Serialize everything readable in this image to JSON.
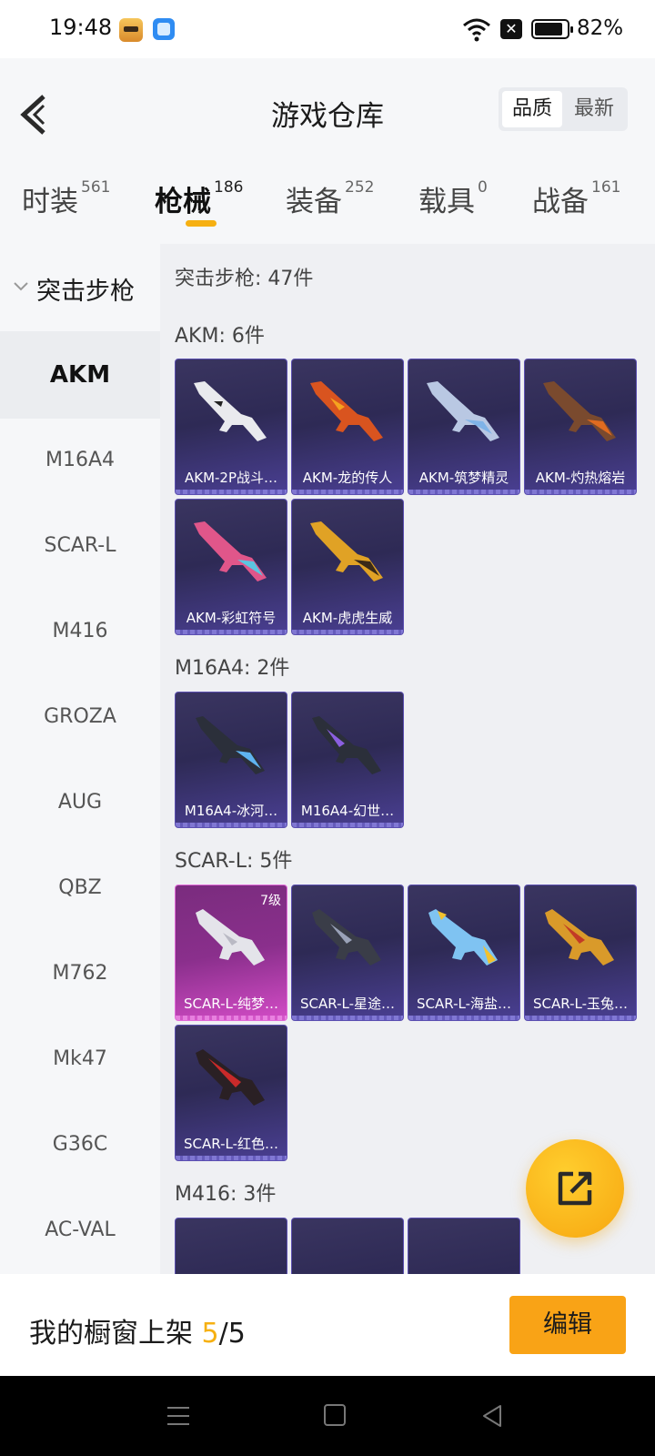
{
  "status_bar": {
    "time": "19:48",
    "battery": "82%"
  },
  "header": {
    "title": "游戏仓库",
    "sort_options": [
      "品质",
      "最新"
    ]
  },
  "tabs": [
    {
      "label": "时装",
      "count": "561"
    },
    {
      "label": "枪械",
      "count": "186"
    },
    {
      "label": "装备",
      "count": "252"
    },
    {
      "label": "载具",
      "count": "0"
    },
    {
      "label": "战备",
      "count": "161"
    }
  ],
  "sidebar": {
    "category": "突击步枪",
    "items": [
      "AKM",
      "M16A4",
      "SCAR-L",
      "M416",
      "GROZA",
      "AUG",
      "QBZ",
      "M762",
      "Mk47",
      "G36C",
      "AC-VAL"
    ]
  },
  "content": {
    "summary": "突击步枪: 47件",
    "sections": [
      {
        "title": "AKM: 6件",
        "items": [
          "AKM-2P战斗…",
          "AKM-龙的传人",
          "AKM-筑梦精灵",
          "AKM-灼热熔岩",
          "AKM-彩虹符号",
          "AKM-虎虎生威"
        ]
      },
      {
        "title": "M16A4: 2件",
        "items": [
          "M16A4-冰河…",
          "M16A4-幻世…"
        ]
      },
      {
        "title": "SCAR-L: 5件",
        "items": [
          "SCAR-L-纯梦…",
          "SCAR-L-星途…",
          "SCAR-L-海盐…",
          "SCAR-L-玉兔…",
          "SCAR-L-红色…"
        ],
        "level_badge": "7级"
      },
      {
        "title": "M416: 3件"
      }
    ]
  },
  "bottom": {
    "showcase_label": "我的橱窗上架",
    "showcase_current": "5",
    "showcase_sep": "/",
    "showcase_total": "5",
    "edit_label": "编辑"
  },
  "colors": {
    "accent": "#f6b012",
    "card": "#2e2a55",
    "card_legendary": "#d34cc6"
  }
}
